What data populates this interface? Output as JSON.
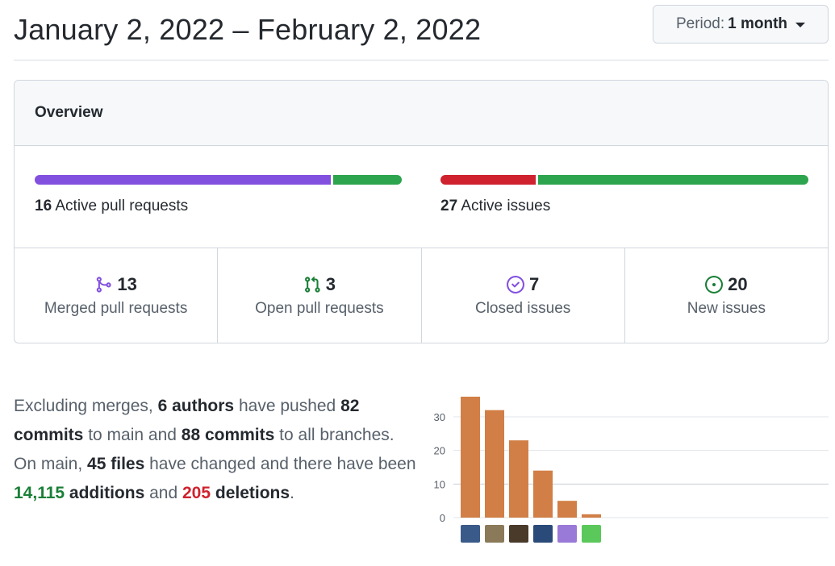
{
  "header": {
    "date_range": "January 2, 2022 – February 2, 2022",
    "period_label": "Period:",
    "period_value": "1 month"
  },
  "overview": {
    "title": "Overview",
    "pull_requests_bar": {
      "count": "16",
      "label": "Active pull requests",
      "merged_fraction": 0.8125,
      "open_fraction": 0.1875,
      "merged_color": "#8250df",
      "open_color": "#2da44e"
    },
    "issues_bar": {
      "count": "27",
      "label": "Active issues",
      "closed_fraction": 0.26,
      "new_fraction": 0.74,
      "closed_color": "#cf222e",
      "new_color": "#2da44e"
    },
    "stats": [
      {
        "icon": "merged-pr-icon",
        "value": "13",
        "label": "Merged pull requests",
        "color": "#8250df"
      },
      {
        "icon": "open-pr-icon",
        "value": "3",
        "label": "Open pull requests",
        "color": "#1a7f37"
      },
      {
        "icon": "closed-issue-icon",
        "value": "7",
        "label": "Closed issues",
        "color": "#8250df"
      },
      {
        "icon": "new-issue-icon",
        "value": "20",
        "label": "New issues",
        "color": "#1a7f37"
      }
    ]
  },
  "summary": {
    "t1": "Excluding merges, ",
    "authors": "6 authors",
    "t2": " have pushed ",
    "commits_main": "82 commits",
    "t3": " to main and ",
    "commits_all": "88 commits",
    "t4": " to all branches. On main, ",
    "files": "45 files",
    "t5": " have changed and there have been ",
    "additions_num": "14,115",
    "additions_word": "additions",
    "t6": " and ",
    "deletions_num": "205",
    "deletions_word": "deletions",
    "t7": "."
  },
  "chart_data": {
    "type": "bar",
    "categories": [
      "author-1",
      "author-2",
      "author-3",
      "author-4",
      "author-5",
      "author-6"
    ],
    "values": [
      36,
      32,
      23,
      14,
      5,
      1
    ],
    "ylim": [
      0,
      36
    ],
    "yticks": [
      "0",
      "10",
      "20",
      "30"
    ],
    "bar_color": "#d17f46",
    "grid": true
  },
  "avatars": [
    {
      "name": "avatar-1",
      "color": "#3a5a8a"
    },
    {
      "name": "avatar-2",
      "color": "#8a7a5a"
    },
    {
      "name": "avatar-3",
      "color": "#4a3a2a"
    },
    {
      "name": "avatar-4",
      "color": "#2a4a7a"
    },
    {
      "name": "avatar-5",
      "color": "#9a7ad8"
    },
    {
      "name": "avatar-6",
      "color": "#5ac85a"
    }
  ]
}
